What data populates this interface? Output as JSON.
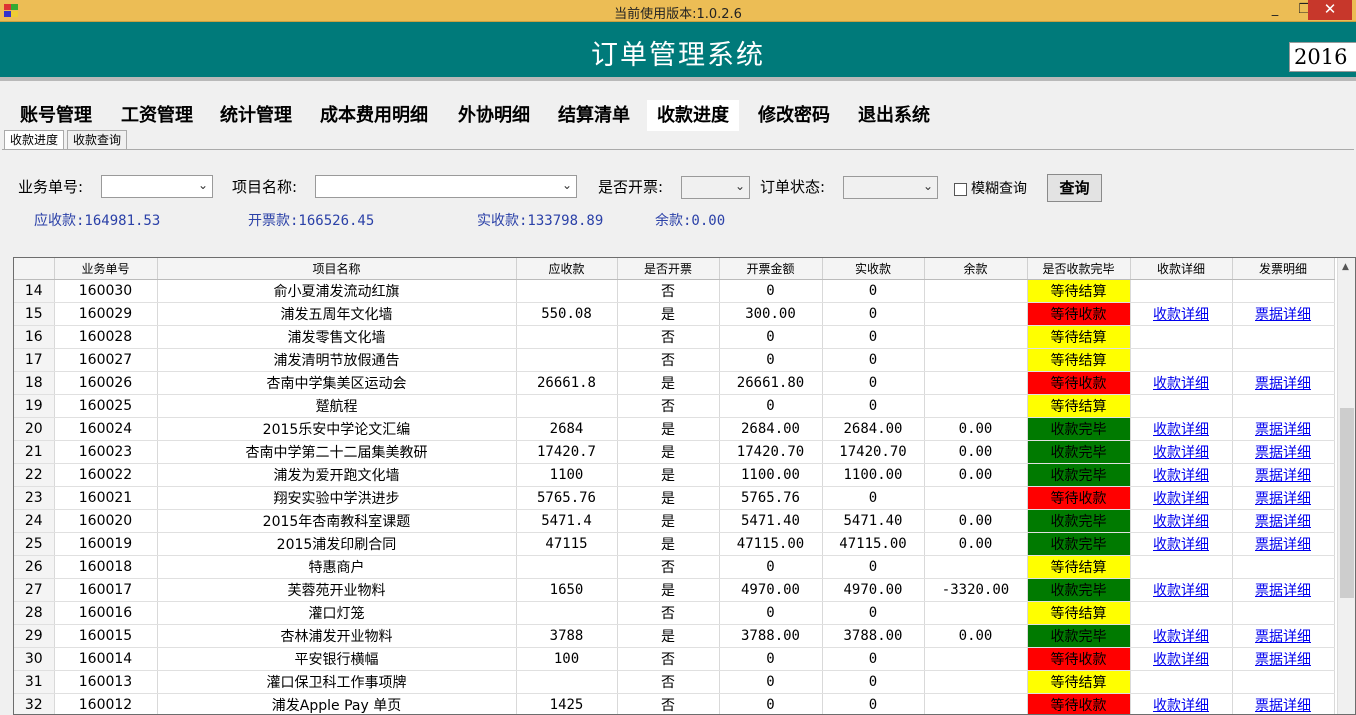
{
  "window": {
    "title": "当前使用版本:1.0.2.6",
    "minimize": "_",
    "restore": "❐",
    "close": "✕"
  },
  "header": {
    "title": "订单管理系统",
    "year": "2016"
  },
  "menu": [
    "账号管理",
    "工资管理",
    "统计管理",
    "成本费用明细",
    "外协明细",
    "结算清单",
    "收款进度",
    "修改密码",
    "退出系统"
  ],
  "menu_active": "收款进度",
  "subtabs": [
    "收款进度",
    "收款查询"
  ],
  "filters": {
    "order_no_label": "业务单号:",
    "project_label": "项目名称:",
    "invoice_label": "是否开票:",
    "status_label": "订单状态:",
    "fuzzy_label": "模糊查询",
    "query_button": "查询"
  },
  "summary": {
    "receivable": "应收款:164981.53",
    "invoiced": "开票款:166526.45",
    "received": "实收款:133798.89",
    "balance": "余款:0.00"
  },
  "table": {
    "columns": [
      "业务单号",
      "项目名称",
      "应收款",
      "是否开票",
      "开票金额",
      "实收款",
      "余款",
      "是否收款完毕",
      "收款详细",
      "发票明细"
    ],
    "rows": [
      {
        "n": "14",
        "id": "160030",
        "name": "俞小夏浦发流动红旗",
        "due": "",
        "inv": "否",
        "inv_amt": "0",
        "paid": "0",
        "bal": "",
        "status": "等待结算",
        "color": "yellow",
        "detail": "",
        "invoice": ""
      },
      {
        "n": "15",
        "id": "160029",
        "name": "浦发五周年文化墙",
        "due": "550.08",
        "inv": "是",
        "inv_amt": "300.00",
        "paid": "0",
        "bal": "",
        "status": "等待收款",
        "color": "red",
        "detail": "收款详细",
        "invoice": "票据详细"
      },
      {
        "n": "16",
        "id": "160028",
        "name": "浦发零售文化墙",
        "due": "",
        "inv": "否",
        "inv_amt": "0",
        "paid": "0",
        "bal": "",
        "status": "等待结算",
        "color": "yellow",
        "detail": "",
        "invoice": ""
      },
      {
        "n": "17",
        "id": "160027",
        "name": "浦发清明节放假通告",
        "due": "",
        "inv": "否",
        "inv_amt": "0",
        "paid": "0",
        "bal": "",
        "status": "等待结算",
        "color": "yellow",
        "detail": "",
        "invoice": ""
      },
      {
        "n": "18",
        "id": "160026",
        "name": "杏南中学集美区运动会",
        "due": "26661.8",
        "inv": "是",
        "inv_amt": "26661.80",
        "paid": "0",
        "bal": "",
        "status": "等待收款",
        "color": "red",
        "detail": "收款详细",
        "invoice": "票据详细"
      },
      {
        "n": "19",
        "id": "160025",
        "name": "蹵航程",
        "due": "",
        "inv": "否",
        "inv_amt": "0",
        "paid": "0",
        "bal": "",
        "status": "等待结算",
        "color": "yellow",
        "detail": "",
        "invoice": ""
      },
      {
        "n": "20",
        "id": "160024",
        "name": "2015乐安中学论文汇编",
        "due": "2684",
        "inv": "是",
        "inv_amt": "2684.00",
        "paid": "2684.00",
        "bal": "0.00",
        "status": "收款完毕",
        "color": "green",
        "detail": "收款详细",
        "invoice": "票据详细"
      },
      {
        "n": "21",
        "id": "160023",
        "name": "杏南中学第二十二届集美教研",
        "due": "17420.7",
        "inv": "是",
        "inv_amt": "17420.70",
        "paid": "17420.70",
        "bal": "0.00",
        "status": "收款完毕",
        "color": "green",
        "detail": "收款详细",
        "invoice": "票据详细"
      },
      {
        "n": "22",
        "id": "160022",
        "name": "浦发为爱开跑文化墙",
        "due": "1100",
        "inv": "是",
        "inv_amt": "1100.00",
        "paid": "1100.00",
        "bal": "0.00",
        "status": "收款完毕",
        "color": "green",
        "detail": "收款详细",
        "invoice": "票据详细"
      },
      {
        "n": "23",
        "id": "160021",
        "name": "翔安实验中学洪进步",
        "due": "5765.76",
        "inv": "是",
        "inv_amt": "5765.76",
        "paid": "0",
        "bal": "",
        "status": "等待收款",
        "color": "red",
        "detail": "收款详细",
        "invoice": "票据详细"
      },
      {
        "n": "24",
        "id": "160020",
        "name": "2015年杏南教科室课题",
        "due": "5471.4",
        "inv": "是",
        "inv_amt": "5471.40",
        "paid": "5471.40",
        "bal": "0.00",
        "status": "收款完毕",
        "color": "green",
        "detail": "收款详细",
        "invoice": "票据详细"
      },
      {
        "n": "25",
        "id": "160019",
        "name": "2015浦发印刷合同",
        "due": "47115",
        "inv": "是",
        "inv_amt": "47115.00",
        "paid": "47115.00",
        "bal": "0.00",
        "status": "收款完毕",
        "color": "green",
        "detail": "收款详细",
        "invoice": "票据详细"
      },
      {
        "n": "26",
        "id": "160018",
        "name": "特惠商户",
        "due": "",
        "inv": "否",
        "inv_amt": "0",
        "paid": "0",
        "bal": "",
        "status": "等待结算",
        "color": "yellow",
        "detail": "",
        "invoice": ""
      },
      {
        "n": "27",
        "id": "160017",
        "name": "芙蓉苑开业物料",
        "due": "1650",
        "inv": "是",
        "inv_amt": "4970.00",
        "paid": "4970.00",
        "bal": "-3320.00",
        "status": "收款完毕",
        "color": "green",
        "detail": "收款详细",
        "invoice": "票据详细"
      },
      {
        "n": "28",
        "id": "160016",
        "name": "灌口灯笼",
        "due": "",
        "inv": "否",
        "inv_amt": "0",
        "paid": "0",
        "bal": "",
        "status": "等待结算",
        "color": "yellow",
        "detail": "",
        "invoice": ""
      },
      {
        "n": "29",
        "id": "160015",
        "name": "杏林浦发开业物料",
        "due": "3788",
        "inv": "是",
        "inv_amt": "3788.00",
        "paid": "3788.00",
        "bal": "0.00",
        "status": "收款完毕",
        "color": "green",
        "detail": "收款详细",
        "invoice": "票据详细"
      },
      {
        "n": "30",
        "id": "160014",
        "name": "平安银行横幅",
        "due": "100",
        "inv": "否",
        "inv_amt": "0",
        "paid": "0",
        "bal": "",
        "status": "等待收款",
        "color": "red",
        "detail": "收款详细",
        "invoice": "票据详细"
      },
      {
        "n": "31",
        "id": "160013",
        "name": "灌口保卫科工作事项牌",
        "due": "",
        "inv": "否",
        "inv_amt": "0",
        "paid": "0",
        "bal": "",
        "status": "等待结算",
        "color": "yellow",
        "detail": "",
        "invoice": ""
      },
      {
        "n": "32",
        "id": "160012",
        "name": "浦发Apple Pay 单页",
        "due": "1425",
        "inv": "否",
        "inv_amt": "0",
        "paid": "0",
        "bal": "",
        "status": "等待收款",
        "color": "red",
        "detail": "收款详细",
        "invoice": "票据详细"
      }
    ]
  },
  "colors": {
    "header": "#007a7a",
    "titlebar": "#ecbd55",
    "yellow": "#ffff00",
    "red": "#ff0000",
    "green": "#007a00",
    "link": "#0000ee"
  }
}
